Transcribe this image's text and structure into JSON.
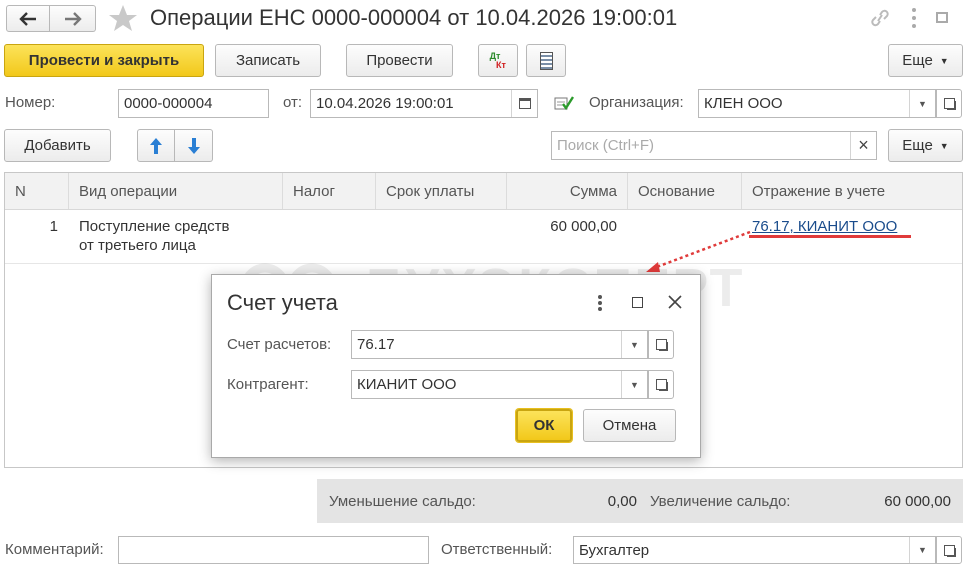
{
  "title": "Операции ЕНС 0000-000004 от 10.04.2026 19:00:01",
  "toolbar": {
    "post_close": "Провести и закрыть",
    "save": "Записать",
    "post": "Провести",
    "dtkt_top": "Дт",
    "dtkt_bottom": "Кт",
    "more": "Еще"
  },
  "header": {
    "number_label": "Номер:",
    "number": "0000-000004",
    "date_label": "от:",
    "date": "10.04.2026 19:00:01",
    "org_label": "Организация:",
    "org": "КЛЕН ООО"
  },
  "table_bar": {
    "add": "Добавить",
    "search_placeholder": "Поиск (Ctrl+F)",
    "clear": "×",
    "more": "Еще"
  },
  "columns": [
    "N",
    "Вид операции",
    "Налог",
    "Срок уплаты",
    "Сумма",
    "Основание",
    "Отражение в учете"
  ],
  "rows": [
    {
      "n": "1",
      "op_line1": "Поступление средств",
      "op_line2": "от третьего лица",
      "tax": "",
      "due": "",
      "sum": "60 000,00",
      "basis": "",
      "account": "76.17, КИАНИТ ООО"
    }
  ],
  "watermark": "БУХЭКСПЕРТ",
  "dialog": {
    "title": "Счет учета",
    "account_label": "Счет расчетов:",
    "account": "76.17",
    "counterparty_label": "Контрагент:",
    "counterparty": "КИАНИТ ООО",
    "ok": "ОК",
    "cancel": "Отмена"
  },
  "totals": {
    "decrease_label": "Уменьшение сальдо:",
    "decrease": "0,00",
    "increase_label": "Увеличение сальдо:",
    "increase": "60 000,00"
  },
  "footer": {
    "comment_label": "Комментарий:",
    "comment": "",
    "responsible_label": "Ответственный:",
    "responsible": "Бухгалтер"
  },
  "colors": {
    "accent_yellow": "#f7d02a",
    "link": "#1a4c8c",
    "red_underline": "#e03b3b"
  }
}
